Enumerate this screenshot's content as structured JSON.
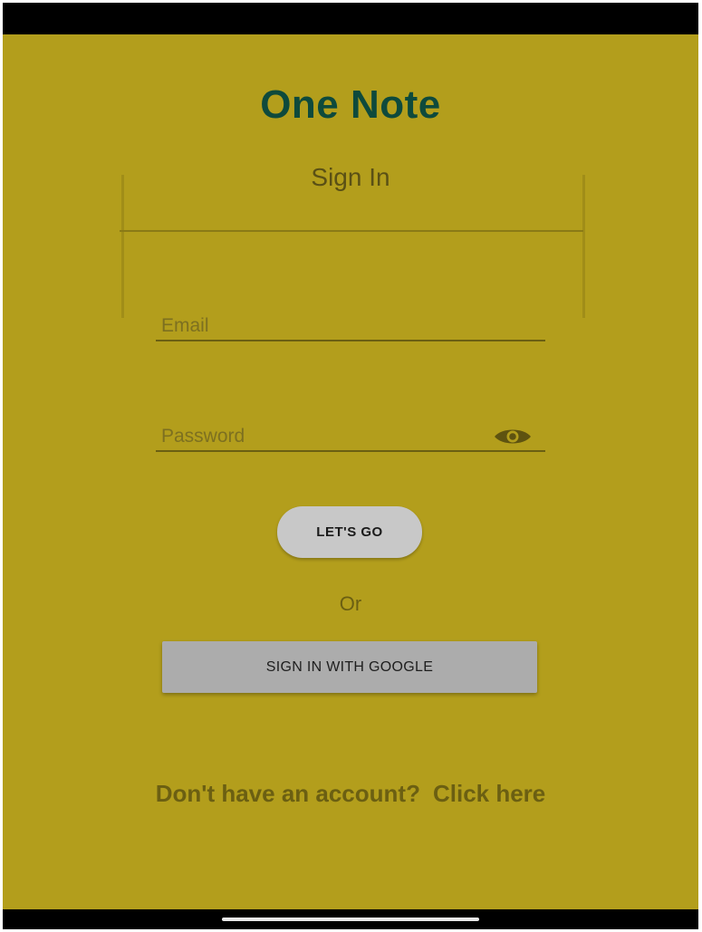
{
  "app": {
    "title": "One Note"
  },
  "signin": {
    "heading": "Sign In"
  },
  "form": {
    "email_placeholder": "Email",
    "password_placeholder": "Password",
    "submit_label": "LET'S GO",
    "or_text": "Or",
    "google_label": "SIGN IN WITH GOOGLE"
  },
  "footer": {
    "prompt": "Don't have an account?",
    "link_label": "Click here"
  },
  "icons": {
    "password_toggle": "eye-icon"
  },
  "colors": {
    "background": "#b39e1c",
    "title": "#0e4a3c",
    "text": "#6b5f12",
    "button": "#c8c8c8",
    "google_button": "#acacac"
  }
}
